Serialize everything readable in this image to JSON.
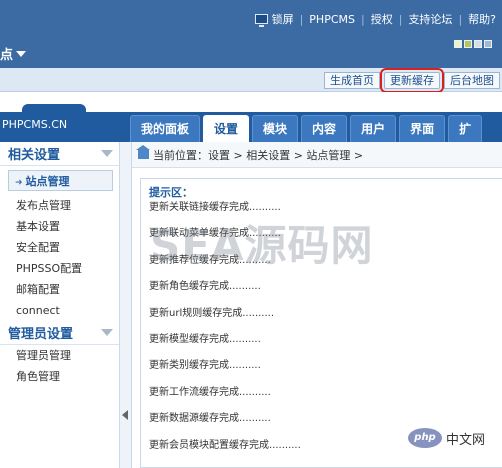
{
  "header": {
    "links": [
      "锁屏",
      "PHPCMS",
      "授权",
      "支持论坛",
      "帮助?"
    ],
    "site_label": "点",
    "theme_colors": [
      "#e9f2c8",
      "#b6c75a",
      "#d5dde6",
      "#9fb8d6"
    ]
  },
  "quickbar": {
    "buttons": [
      "生成首页",
      "更新缓存",
      "后台地图"
    ]
  },
  "logo": "PHPCMS.CN",
  "nav": {
    "tabs": [
      "我的面板",
      "设置",
      "模块",
      "内容",
      "用户",
      "界面",
      "扩"
    ],
    "active": "设置"
  },
  "sidebar": {
    "group1_title": "相关设置",
    "group1_items": [
      "站点管理",
      "发布点管理",
      "基本设置",
      "安全配置",
      "PHPSSO配置",
      "邮箱配置",
      "connect"
    ],
    "group2_title": "管理员设置",
    "group2_items": [
      "管理员管理",
      "角色管理"
    ]
  },
  "breadcrumb": "当前位置：设置 > 相关设置 > 站点管理 >",
  "message": {
    "title": "提示区：",
    "lines": [
      "更新关联链接缓存完成..........",
      "更新联动菜单缓存完成..........",
      "更新推荐位缓存完成..........",
      "更新角色缓存完成..........",
      "更新url规则缓存完成..........",
      "更新模型缓存完成..........",
      "更新类别缓存完成..........",
      "更新工作流缓存完成..........",
      "更新数据源缓存完成..........",
      "更新会员模块配置缓存完成.........."
    ]
  },
  "watermark": "SEA源码网",
  "badge": {
    "logo": "php",
    "text": "中文网"
  }
}
